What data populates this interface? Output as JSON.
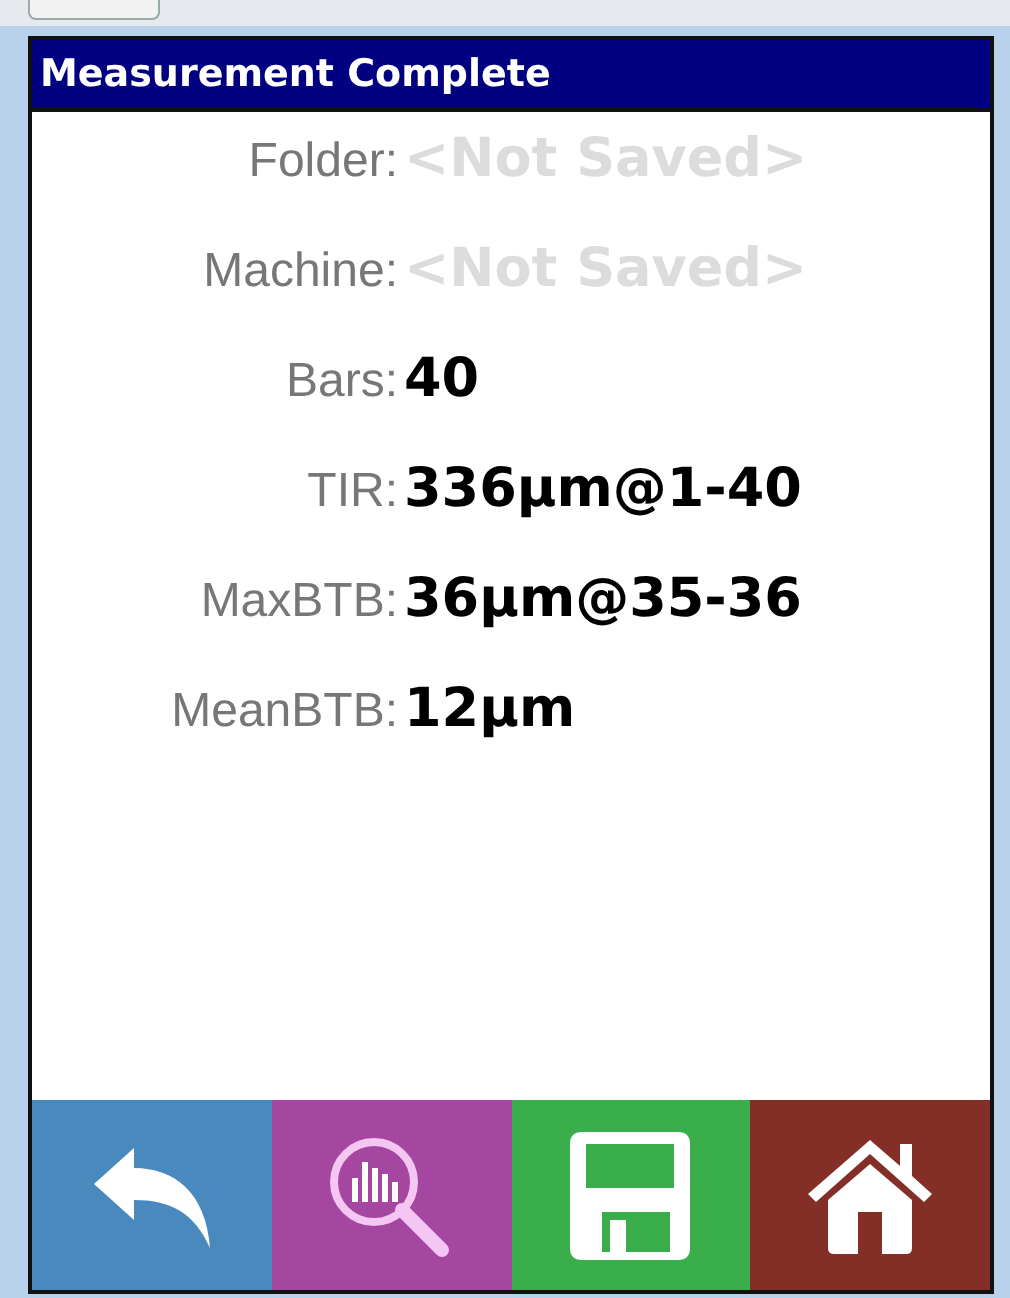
{
  "window": {
    "title": "Measurement Complete"
  },
  "fields": [
    {
      "label": "Folder:",
      "value": "<Not Saved>",
      "empty": true
    },
    {
      "label": "Machine:",
      "value": "<Not Saved>",
      "empty": true
    },
    {
      "label": "Bars:",
      "value": "40",
      "empty": false
    },
    {
      "label": "TIR:",
      "value": "336µm@1-40",
      "empty": false
    },
    {
      "label": "MaxBTB:",
      "value": "36µm@35-36",
      "empty": false
    },
    {
      "label": "MeanBTB:",
      "value": "12µm",
      "empty": false
    }
  ],
  "toolbar": [
    {
      "kind": "back",
      "color": "#4a89be"
    },
    {
      "kind": "analyze",
      "color": "#a547a0"
    },
    {
      "kind": "save",
      "color": "#3aae4a"
    },
    {
      "kind": "home",
      "color": "#832e26"
    }
  ]
}
